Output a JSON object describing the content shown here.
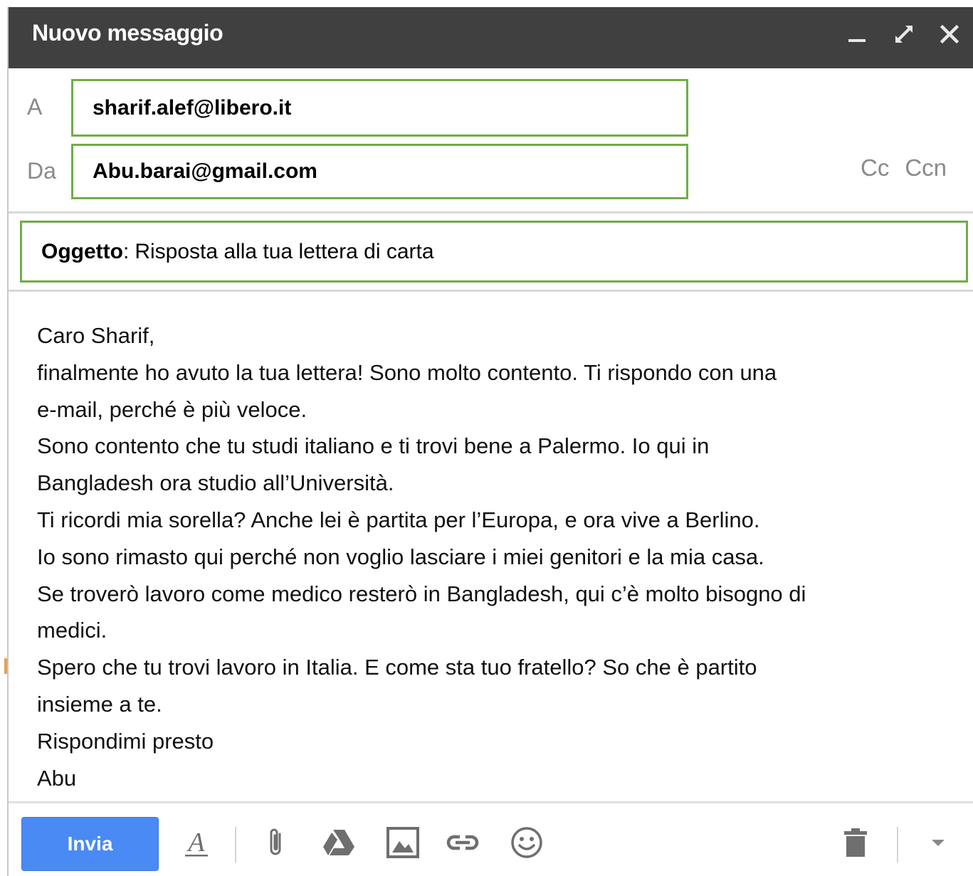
{
  "window": {
    "title": "Nuovo messaggio",
    "controls": {
      "minimize_icon": "minimize-icon",
      "maximize_icon": "expand-icon",
      "close_icon": "close-icon"
    }
  },
  "header": {
    "to_label": "A",
    "to_value": "sharif.alef@libero.it",
    "from_label": "Da",
    "from_value": "Abu.barai@gmail.com",
    "cc_label": "Cc",
    "bcc_label": "Ccn",
    "highlight_color": "#70ad47"
  },
  "subject": {
    "label": "Oggetto",
    "separator": ":",
    "value": "Risposta alla tua lettera di carta"
  },
  "body": {
    "lines": [
      "Caro Sharif,",
      "finalmente ho avuto la tua lettera! Sono molto contento. Ti rispondo con una",
      "e-mail, perché è più veloce.",
      "Sono contento che tu studi italiano e ti trovi bene a Palermo. Io qui in",
      "Bangladesh ora studio all’Università.",
      "Ti ricordi mia sorella? Anche lei è partita per l’Europa, e ora vive a Berlino.",
      "Io sono rimasto qui perché non voglio lasciare i miei genitori e la mia casa.",
      "Se troverò lavoro come medico resterò in Bangladesh, qui c’è molto bisogno di",
      "medici.",
      "Spero che tu trovi lavoro in Italia. E come sta tuo fratello? So che è partito",
      "insieme a te.",
      "Rispondimi presto",
      "Abu"
    ]
  },
  "toolbar": {
    "send_label": "Invia",
    "send_color": "#4a8af4",
    "icons": [
      "text-format-icon",
      "attach-icon",
      "drive-icon",
      "insert-photo-icon",
      "insert-link-icon",
      "emoji-icon",
      "trash-icon",
      "more-options-icon"
    ]
  }
}
